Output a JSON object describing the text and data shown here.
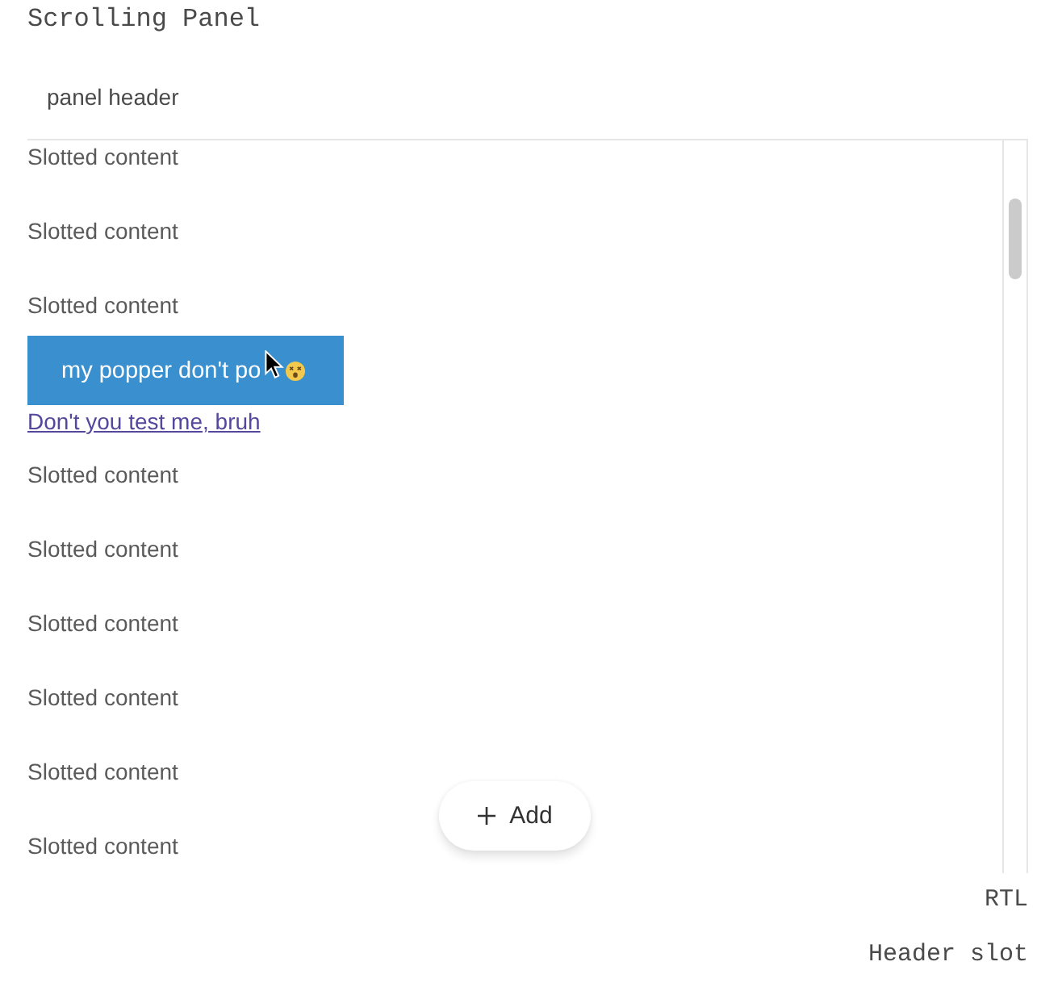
{
  "title": "Scrolling Panel",
  "panel": {
    "header": "panel header",
    "items": [
      {
        "kind": "text",
        "text": "Slotted content"
      },
      {
        "kind": "text",
        "text": "Slotted content"
      },
      {
        "kind": "text",
        "text": "Slotted content"
      },
      {
        "kind": "popper_button",
        "label": "my popper don't po"
      },
      {
        "kind": "link",
        "text": "Don't you test me, bruh"
      },
      {
        "kind": "text",
        "text": "Slotted content"
      },
      {
        "kind": "text",
        "text": "Slotted content"
      },
      {
        "kind": "text",
        "text": "Slotted content"
      },
      {
        "kind": "text",
        "text": "Slotted content"
      },
      {
        "kind": "text",
        "text": "Slotted content"
      },
      {
        "kind": "text",
        "text": "Slotted content"
      }
    ],
    "fab": {
      "label": "Add"
    }
  },
  "footer": [
    "RTL",
    "Header slot"
  ]
}
